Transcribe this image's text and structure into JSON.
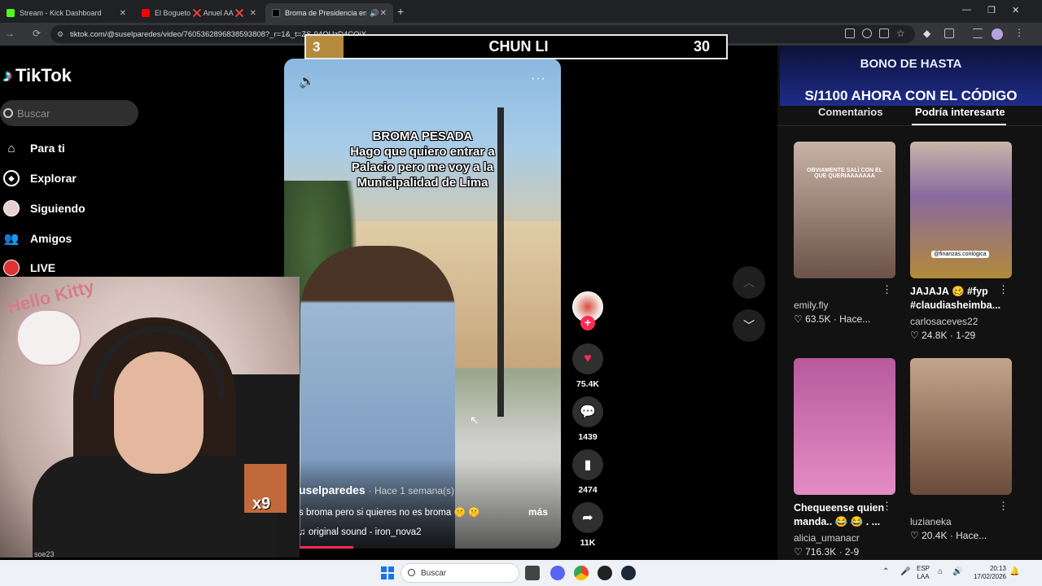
{
  "browser": {
    "tabs": [
      {
        "title": "Stream - Kick Dashboard",
        "color": "#53fc18"
      },
      {
        "title": "El Bogueto ❌ Anuel AA ❌ Yu",
        "color": "#ff0000"
      },
      {
        "title": "Broma de Presidencia en Li",
        "color": "#000000"
      }
    ],
    "url": "tiktok.com/@suselparedes/video/7605362896838593808?_r=1&_t=ZS-94OUzD4CQiX"
  },
  "sidebar": {
    "logo": "TikTok",
    "search_placeholder": "Buscar",
    "nav": [
      {
        "label": "Para ti",
        "icon": "home-icon"
      },
      {
        "label": "Explorar",
        "icon": "compass-icon"
      },
      {
        "label": "Siguiendo",
        "icon": "following-avatar-icon"
      },
      {
        "label": "Amigos",
        "icon": "friends-icon"
      },
      {
        "label": "LIVE",
        "icon": "live-icon"
      }
    ]
  },
  "scoreboard": {
    "rank": "3",
    "name": "CHUN LI",
    "points": "30"
  },
  "video": {
    "caption_lines": [
      "BROMA PESADA",
      "Hago que quiero entrar a",
      "Palacio pero me voy a la",
      "Municipalidad de Lima"
    ],
    "username": "uselparedes",
    "time": "· Hace 1 semana(s)",
    "description": "s broma pero si quieres no es broma 🤫 🤫",
    "more": "más",
    "sound": "original sound - iron_nova2",
    "progress": 0.25
  },
  "actions": {
    "likes": "75.4K",
    "comments": "1439",
    "saves": "2474",
    "shares": "11K"
  },
  "webcam": {
    "wall_text": "Hello Kitty",
    "sticker_count": "x9",
    "bottom_user": "soe23"
  },
  "right_panel": {
    "banner_line1": "BONO DE HASTA",
    "banner_line2": "S/1100 AHORA CON EL CÓDIGO",
    "tabs": [
      "Comentarios",
      "Podría interesarte"
    ],
    "cards": [
      {
        "title": "",
        "user": "emily.fly",
        "likes": "63.5K",
        "time": "· Hace...",
        "thumb_text": "OBVIAMENTE SALÍ CON EL QUE QUERIAAAAAAA",
        "colors": [
          "#c8b2a6",
          "#6c5248"
        ]
      },
      {
        "title": "JAJAJA 🥴 #fyp #claudiasheimba...",
        "user": "carlosaceves22",
        "likes": "24.8K",
        "time": "· 1-29",
        "thumb_tag": "@finanzas.conlogica",
        "colors": [
          "#8a6aa0",
          "#b28a3a"
        ]
      },
      {
        "title": "Chequeense quien manda.. 😂 😂 . ...",
        "user": "alicia_umanacr",
        "likes": "716.3K",
        "time": "· 2-9",
        "colors": [
          "#d67ab6",
          "#e48cc4"
        ]
      },
      {
        "title": "",
        "user": "luzianeka",
        "likes": "20.4K",
        "time": "· Hace...",
        "colors": [
          "#c4a48a",
          "#6a4a3a"
        ]
      }
    ]
  },
  "taskbar": {
    "search_placeholder": "Buscar",
    "lang": "ESP",
    "lang_sub": "LAA",
    "time": "20:13",
    "date": "17/02/2026"
  }
}
